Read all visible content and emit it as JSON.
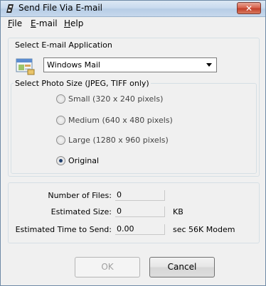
{
  "window": {
    "title": "Send File Via E-mail",
    "close_label": "✕"
  },
  "menu": [
    {
      "label": "File",
      "accel": "F",
      "rest": "ile"
    },
    {
      "label": "E-mail",
      "accel": "E",
      "rest": "-mail"
    },
    {
      "label": "Help",
      "accel": "H",
      "rest": "elp"
    }
  ],
  "email_app": {
    "group_label": "Select E-mail Application",
    "selected": "Windows Mail"
  },
  "photo_size": {
    "group_label": "Select Photo Size (JPEG, TIFF only)",
    "options": [
      {
        "label": "Small (320 x 240 pixels)",
        "checked": false
      },
      {
        "label": "Medium (640 x 480 pixels)",
        "checked": false
      },
      {
        "label": "Large (1280 x 960 pixels)",
        "checked": false
      },
      {
        "label": "Original",
        "checked": true
      }
    ]
  },
  "info": {
    "files_label": "Number of Files:",
    "files_value": "0",
    "size_label": "Estimated Size:",
    "size_value": "0",
    "size_unit": "KB",
    "time_label": "Estimated Time to Send:",
    "time_value": "0.00",
    "time_unit": "sec 56K Modem"
  },
  "buttons": {
    "ok": "OK",
    "cancel": "Cancel"
  }
}
